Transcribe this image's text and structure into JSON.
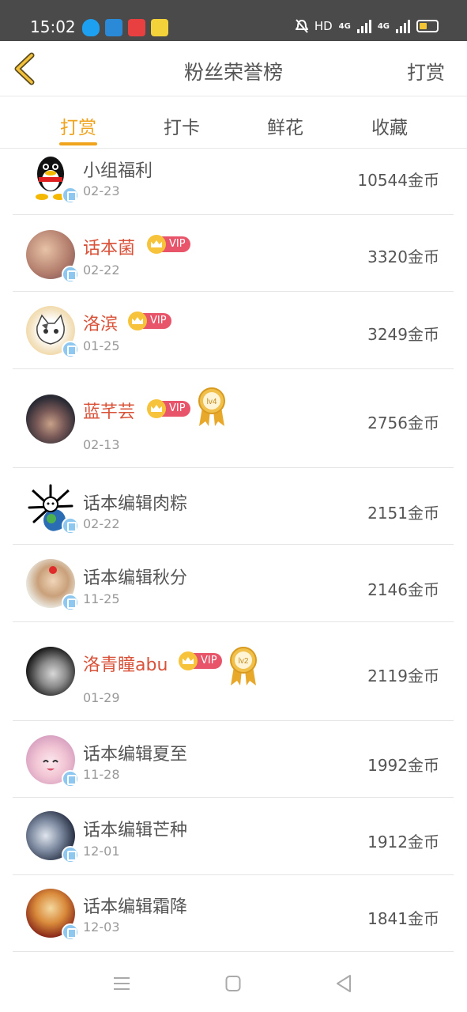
{
  "status_bar": {
    "time": "15:02",
    "hd": "HD",
    "net1": "4G",
    "net2": "4G"
  },
  "nav": {
    "title": "粉丝荣誉榜",
    "right_action": "打赏"
  },
  "tabs": [
    {
      "label": "打赏",
      "active": true
    },
    {
      "label": "打卡",
      "active": false
    },
    {
      "label": "鲜花",
      "active": false
    },
    {
      "label": "收藏",
      "active": false
    }
  ],
  "vip_label": "VIP",
  "medals": [
    "lv4",
    "lv2"
  ],
  "rows": [
    {
      "name": "小组福利",
      "date": "02-23",
      "coins": "10544金币"
    },
    {
      "name": "话本菌",
      "date": "02-22",
      "coins": "3320金币"
    },
    {
      "name": "洛滨",
      "date": "01-25",
      "coins": "3249金币"
    },
    {
      "name": "蓝芊芸",
      "date": "02-13",
      "coins": "2756金币"
    },
    {
      "name": "话本编辑肉粽",
      "date": "02-22",
      "coins": "2151金币"
    },
    {
      "name": "话本编辑秋分",
      "date": "11-25",
      "coins": "2146金币"
    },
    {
      "name": "洛青瞳abu",
      "date": "01-29",
      "coins": "2119金币"
    },
    {
      "name": "话本编辑夏至",
      "date": "11-28",
      "coins": "1992金币"
    },
    {
      "name": "话本编辑芒种",
      "date": "12-01",
      "coins": "1912金币"
    },
    {
      "name": "话本编辑霜降",
      "date": "12-03",
      "coins": "1841金币"
    }
  ],
  "colors": {
    "accent": "#f0a31d",
    "vip_name": "#d9533a",
    "vip_badge": "#e8556a"
  }
}
